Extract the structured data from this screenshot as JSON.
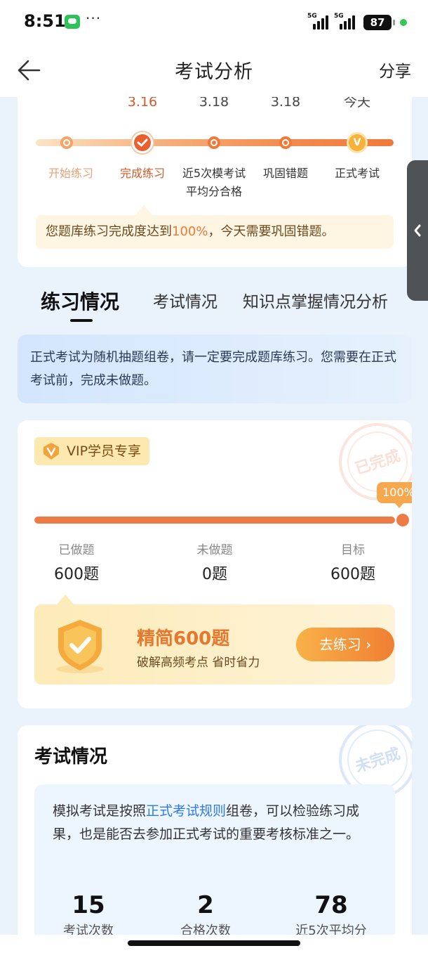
{
  "status_bar": {
    "time": "8:51",
    "dots": "···",
    "net1": "5G",
    "net2": "5G",
    "battery": "87"
  },
  "nav": {
    "title": "考试分析",
    "share": "分享"
  },
  "steps": {
    "dates": [
      "3.16",
      "3.18",
      "3.18",
      "今天"
    ],
    "labels": [
      "开始练习",
      "完成练习",
      "近5次模考试\n平均分合格",
      "巩固错题",
      "正式考试"
    ],
    "vip_mark": "V",
    "tip_prefix": "您题库练习完成度达到",
    "tip_highlight": "100%",
    "tip_suffix": "，今天需要巩固错题。"
  },
  "tabs": [
    "练习情况",
    "考试情况",
    "知识点掌握情况分析"
  ],
  "info_banner": "正式考试为随机抽题组卷，请一定要完成题库练习。您需要在正式考试前，完成未做题。",
  "practice": {
    "stamp": "已完成",
    "vip_label": "VIP学员专享",
    "percent": "100%",
    "progress": 1.0,
    "stats": [
      {
        "label": "已做题",
        "value": "600题"
      },
      {
        "label": "未做题",
        "value": "0题"
      },
      {
        "label": "目标",
        "value": "600题"
      }
    ],
    "promo_title": "精简600题",
    "promo_sub": "破解高频考点 省时省力",
    "go_label": "去练习 ›"
  },
  "exam": {
    "title": "考试情况",
    "stamp": "未完成",
    "note_prefix": "模拟考试是按照",
    "note_link": "正式考试规则",
    "note_suffix": "组卷，可以检验练习成果，也是能否去参加正式考试的重要考核标准之一。",
    "stats": [
      {
        "value": "15",
        "label": "考试次数"
      },
      {
        "value": "2",
        "label": "合格次数"
      },
      {
        "value": "78",
        "label": "近5次平均分"
      }
    ]
  }
}
